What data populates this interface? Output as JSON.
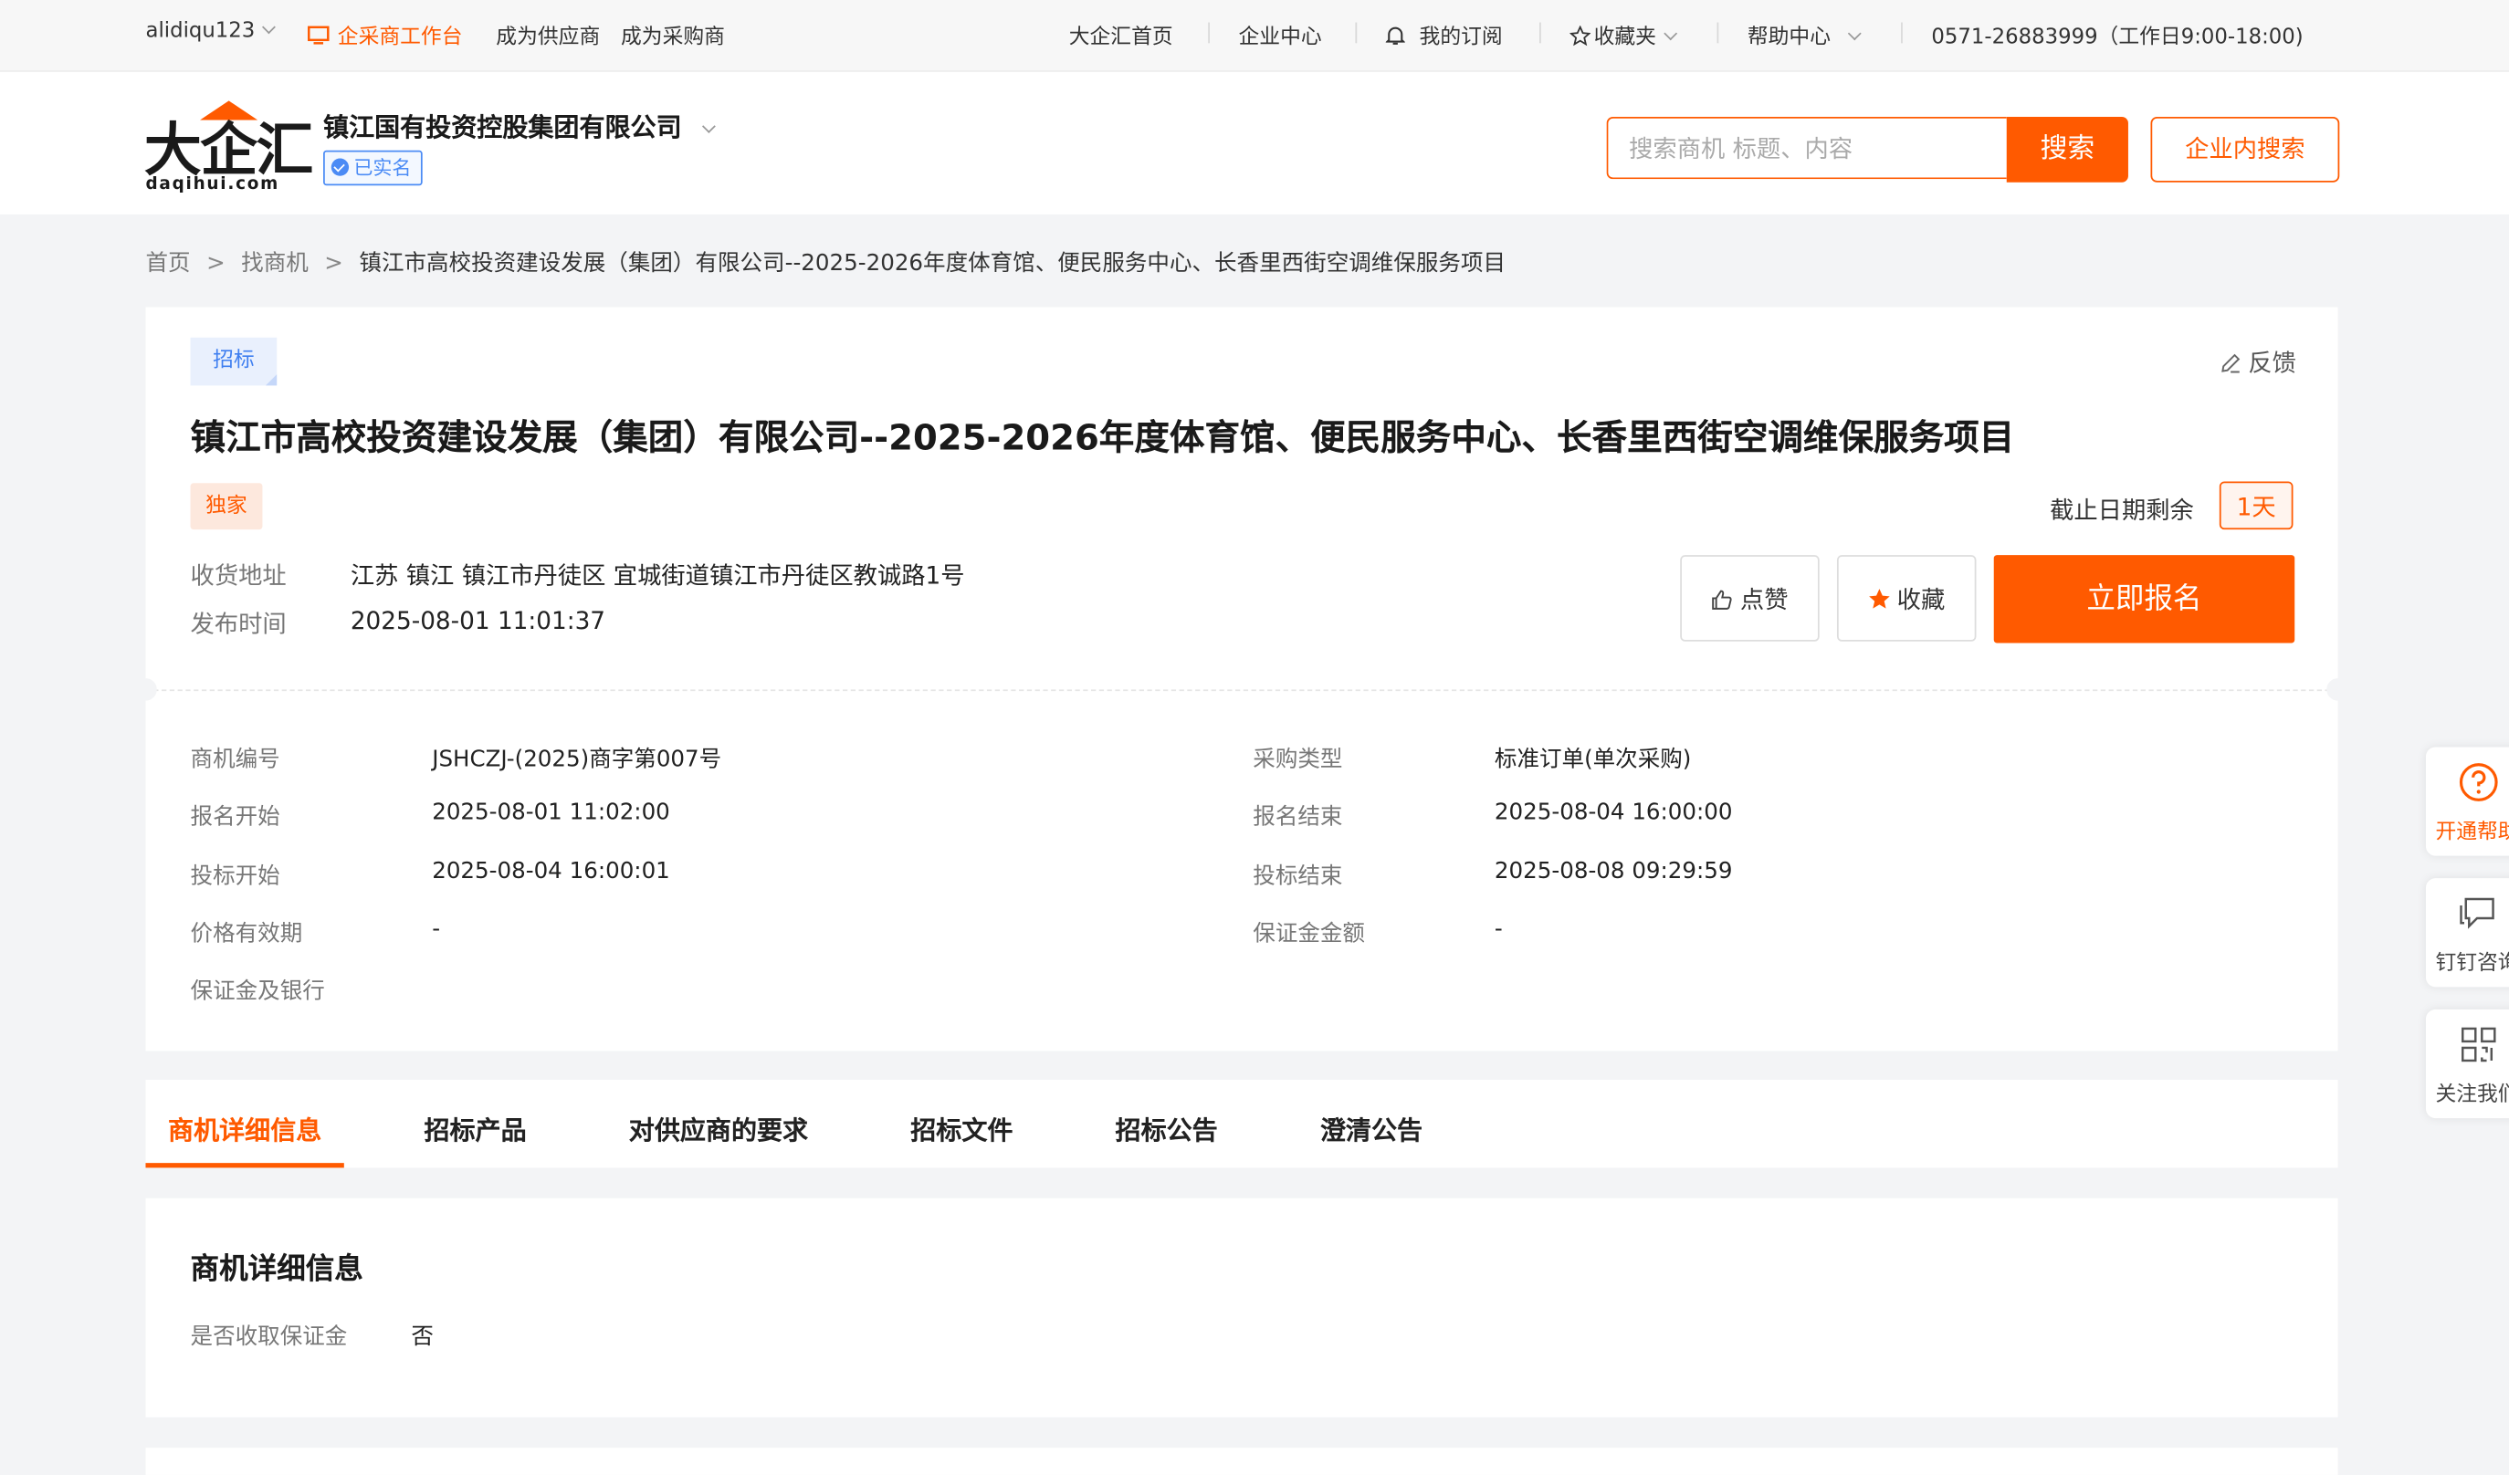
{
  "topbar": {
    "user": "alidiqu123",
    "workbench": "企采商工作台",
    "become_supplier": "成为供应商",
    "become_buyer": "成为采购商",
    "home": "大企汇首页",
    "enterprise_center": "企业中心",
    "subscription": "我的订阅",
    "favorites": "收藏夹",
    "help": "帮助中心",
    "hotline": "0571-26883999（工作日9:00-18:00)"
  },
  "header": {
    "logo_cn": "大企汇",
    "logo_en": "daqihui.com",
    "company": "镇江国有投资控股集团有限公司",
    "verified": "已实名",
    "search_placeholder": "搜索商机 标题、内容",
    "search_btn": "搜索",
    "inner_search_btn": "企业内搜索"
  },
  "breadcrumb": {
    "home": "首页",
    "opps": "找商机",
    "current": "镇江市高校投资建设发展（集团）有限公司--2025-2026年度体育馆、便民服务中心、长香里西街空调维保服务项目"
  },
  "opportunity": {
    "tag": "招标",
    "feedback": "反馈",
    "title": "镇江市高校投资建设发展（集团）有限公司--2025-2026年度体育馆、便民服务中心、长香里西街空调维保服务项目",
    "exclusive": "独家",
    "deadline_label": "截止日期剩余",
    "deadline_value": "1天",
    "address_label": "收货地址",
    "address_value": "江苏 镇江 镇江市丹徒区 宜城街道镇江市丹徒区教诚路1号",
    "publish_label": "发布时间",
    "publish_value": "2025-08-01 11:01:37",
    "like_btn": "点赞",
    "fav_btn": "收藏",
    "signup_btn": "立即报名"
  },
  "details": [
    {
      "label": "商机编号",
      "value": "JSHCZJ-(2025)商字第007号"
    },
    {
      "label": "采购类型",
      "value": "标准订单(单次采购)"
    },
    {
      "label": "报名开始",
      "value": "2025-08-01 11:02:00"
    },
    {
      "label": "报名结束",
      "value": "2025-08-04 16:00:00"
    },
    {
      "label": "投标开始",
      "value": "2025-08-04 16:00:01"
    },
    {
      "label": "投标结束",
      "value": "2025-08-08 09:29:59"
    },
    {
      "label": "价格有效期",
      "value": "-"
    },
    {
      "label": "保证金金额",
      "value": "-"
    },
    {
      "label": "保证金及银行",
      "value": ""
    }
  ],
  "tabs": [
    "商机详细信息",
    "招标产品",
    "对供应商的要求",
    "招标文件",
    "招标公告",
    "澄清公告"
  ],
  "detail_section": {
    "heading": "商机详细信息",
    "deposit_label": "是否收取保证金",
    "deposit_value": "否"
  },
  "side": {
    "help": "开通帮助",
    "dingtalk": "钉钉咨询",
    "follow": "关注我们"
  },
  "colors": {
    "accent": "#ff5a00",
    "blue": "#4b8bf5"
  }
}
